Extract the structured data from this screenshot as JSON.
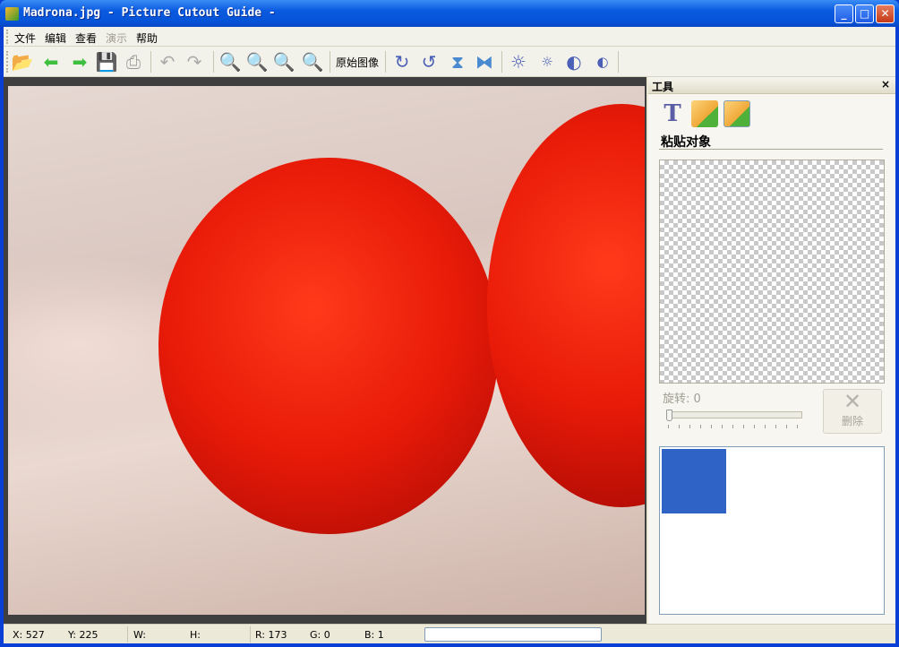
{
  "window": {
    "title": "Madrona.jpg - Picture Cutout Guide -",
    "minimize": "_",
    "maximize": "□",
    "close": "✕"
  },
  "menu": [
    {
      "label": "文件",
      "enabled": true
    },
    {
      "label": "编辑",
      "enabled": true
    },
    {
      "label": "查看",
      "enabled": true
    },
    {
      "label": "演示",
      "enabled": false
    },
    {
      "label": "帮助",
      "enabled": true
    }
  ],
  "toolbar": {
    "original_image": "原始图像"
  },
  "panel": {
    "title": "工具",
    "close": "×",
    "section_title": "粘贴对象",
    "rotation_label": "旋转: 0",
    "rotation_value": 0,
    "delete_label": "删除",
    "delete_icon": "✕",
    "text_tool": "T",
    "swatch_color": "#2f63c6"
  },
  "status": {
    "x": "X: 527",
    "y": "Y: 225",
    "w": "W:",
    "h": "H:",
    "r": "R: 173",
    "g": "G: 0",
    "b": "B: 1"
  }
}
